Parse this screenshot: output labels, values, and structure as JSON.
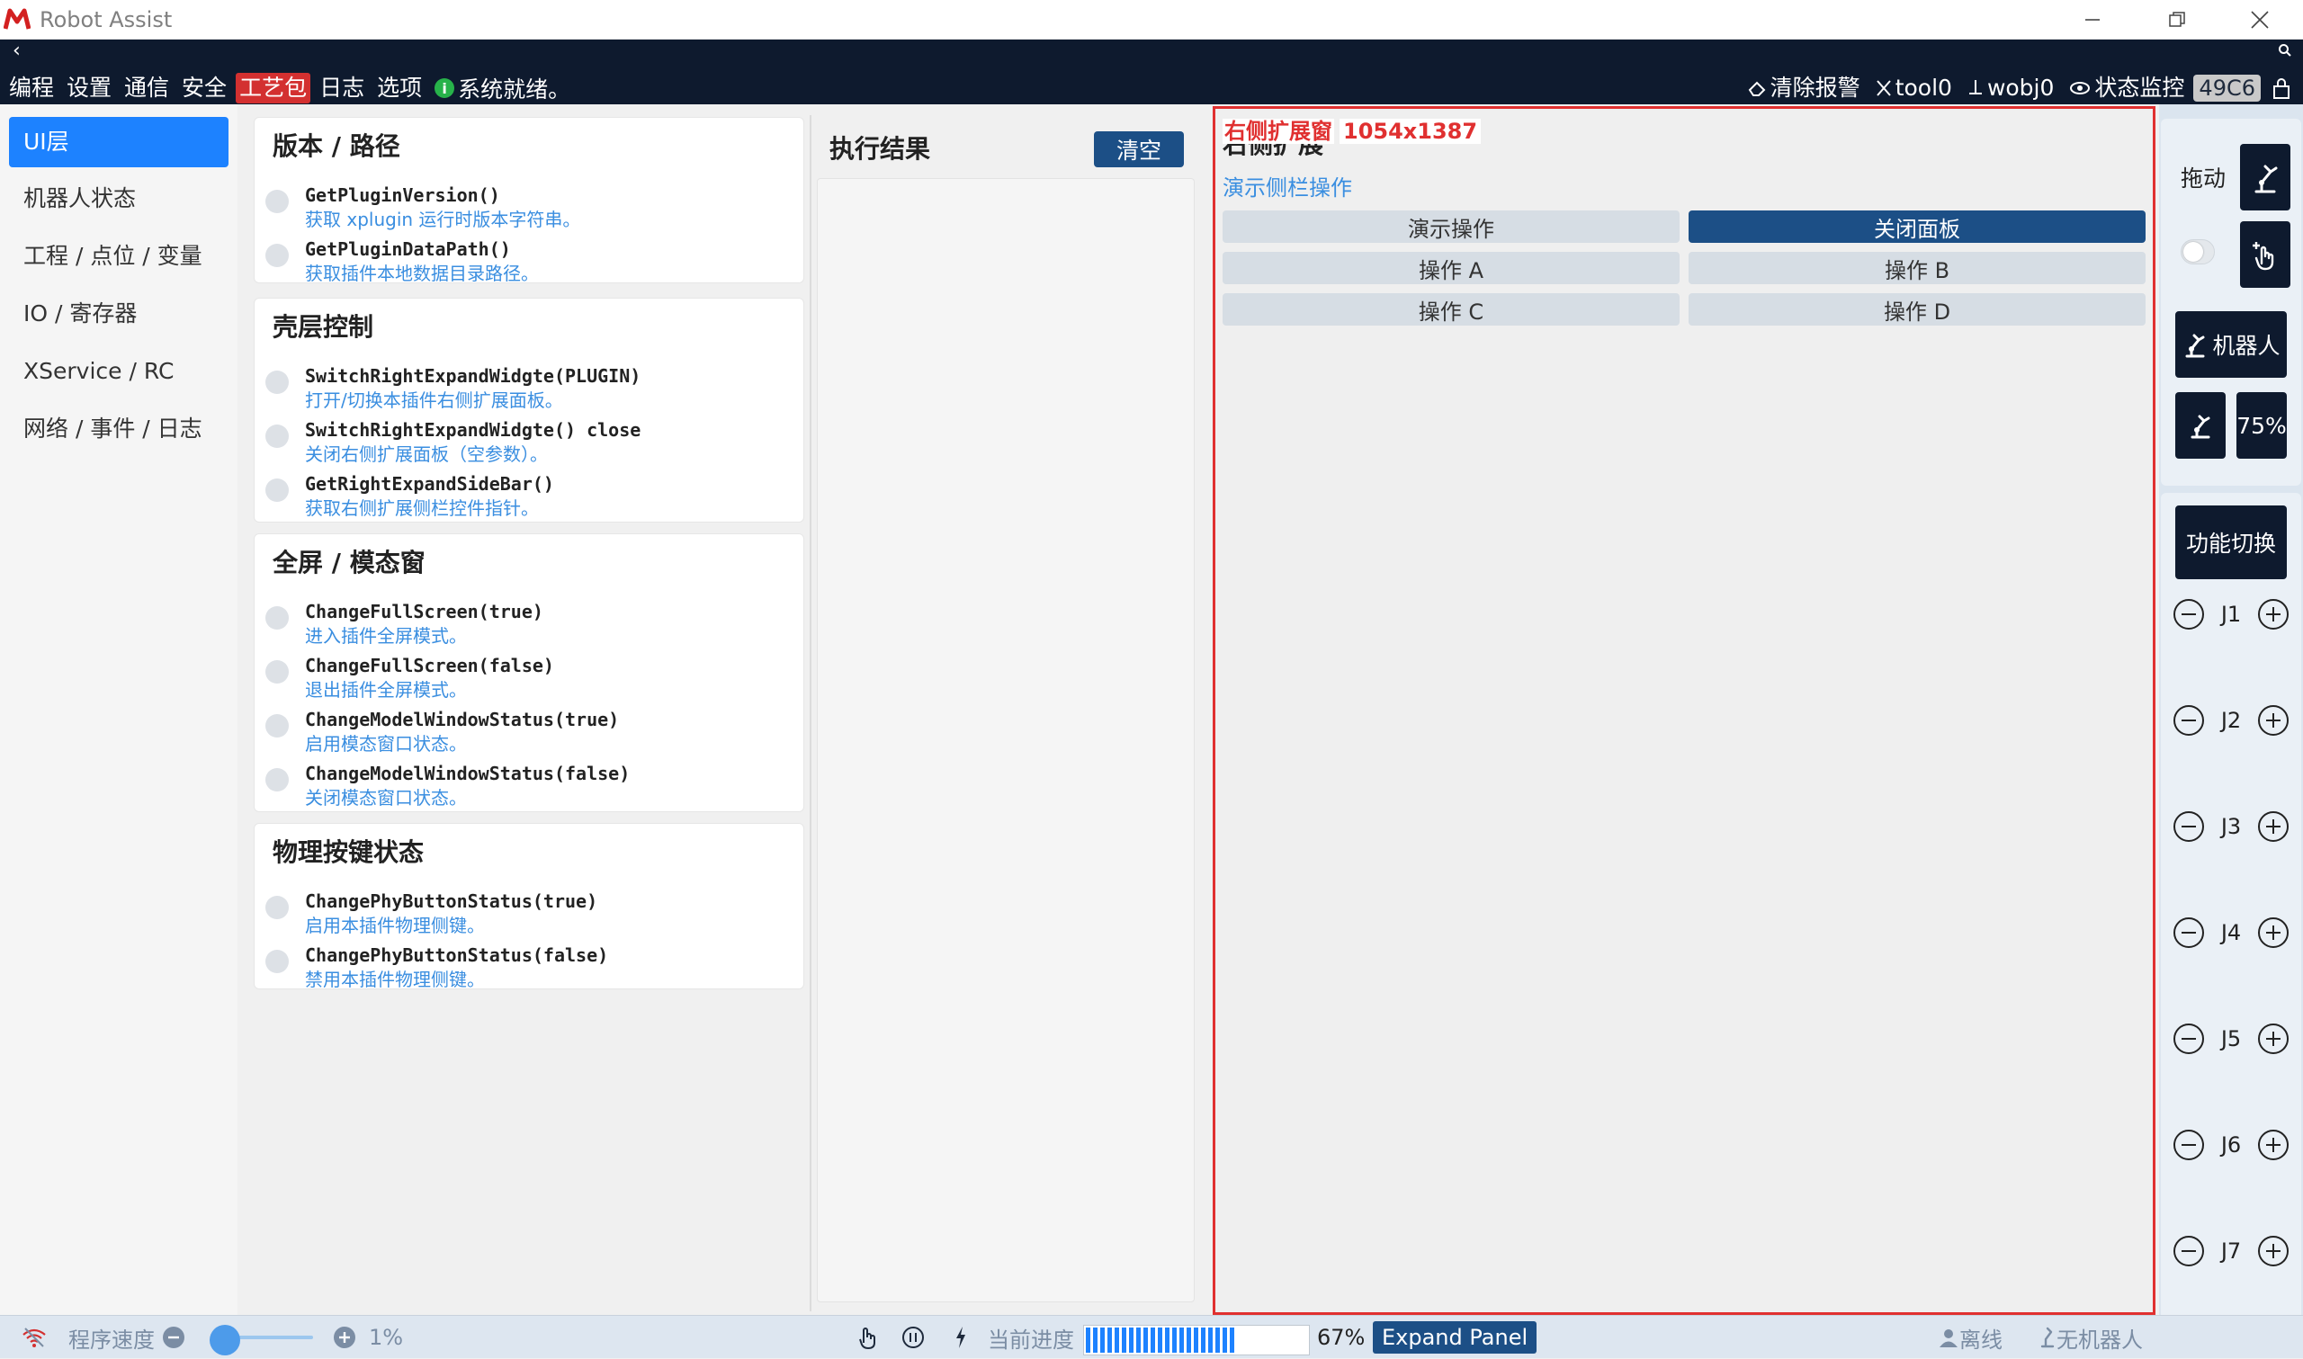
{
  "window": {
    "title": "Robot Assist"
  },
  "menu": {
    "items": [
      "编程",
      "设置",
      "通信",
      "安全",
      "工艺包",
      "日志",
      "选项"
    ],
    "active_index": 4,
    "status_text": "系统就绪。"
  },
  "topright": {
    "clear_alarm": "清除报警",
    "tool": "tool0",
    "wobj": "wobj0",
    "monitor": "状态监控",
    "code": "49C6"
  },
  "sidebar": {
    "items": [
      "UI层",
      "机器人状态",
      "工程 / 点位 / 变量",
      "IO / 寄存器",
      "XService / RC",
      "网络 / 事件 / 日志"
    ],
    "active_index": 0
  },
  "api_cards": [
    {
      "title": "版本 / 路径",
      "apis": [
        {
          "name": "GetPluginVersion()",
          "desc": "获取 xplugin 运行时版本字符串。"
        },
        {
          "name": "GetPluginDataPath()",
          "desc": "获取插件本地数据目录路径。"
        }
      ]
    },
    {
      "title": "壳层控制",
      "apis": [
        {
          "name": "SwitchRightExpandWidgte(PLUGIN)",
          "desc": "打开/切换本插件右侧扩展面板。"
        },
        {
          "name": "SwitchRightExpandWidgte() close",
          "desc": "关闭右侧扩展面板（空参数）。"
        },
        {
          "name": "GetRightExpandSideBar()",
          "desc": "获取右侧扩展侧栏控件指针。"
        }
      ]
    },
    {
      "title": "全屏 / 模态窗",
      "apis": [
        {
          "name": "ChangeFullScreen(true)",
          "desc": "进入插件全屏模式。"
        },
        {
          "name": "ChangeFullScreen(false)",
          "desc": "退出插件全屏模式。"
        },
        {
          "name": "ChangeModelWindowStatus(true)",
          "desc": "启用模态窗口状态。"
        },
        {
          "name": "ChangeModelWindowStatus(false)",
          "desc": "关闭模态窗口状态。"
        }
      ]
    },
    {
      "title": "物理按键状态",
      "apis": [
        {
          "name": "ChangePhyButtonStatus(true)",
          "desc": "启用本插件物理侧键。"
        },
        {
          "name": "ChangePhyButtonStatus(false)",
          "desc": "禁用本插件物理侧键。"
        }
      ]
    }
  ],
  "result": {
    "title": "执行结果",
    "clear_label": "清空"
  },
  "expand_panel": {
    "tag_name": "右侧扩展窗",
    "tag_size": "1054x1387",
    "title": "右侧扩展",
    "subtitle": "演示侧栏操作",
    "buttons": [
      "演示操作",
      "关闭面板",
      "操作 A",
      "操作 B",
      "操作 C",
      "操作 D"
    ]
  },
  "rightbar": {
    "drag_label": "拖动",
    "robot_label": "机器人",
    "speed_label": "75%",
    "func_label": "功能切换",
    "joints": [
      "J1",
      "J2",
      "J3",
      "J4",
      "J5",
      "J6",
      "J7"
    ]
  },
  "statusbar": {
    "speed_label": "程序速度",
    "speed_value": "1%",
    "speed_fraction": 0.01,
    "progress_label": "当前进度",
    "progress_value": "67%",
    "progress_fraction": 0.67,
    "expand_label": "Expand Panel",
    "offline": "离线",
    "no_robot": "无机器人"
  },
  "colors": {
    "accent": "#1d82ff",
    "dark": "#0e1a2e",
    "alert": "#e03030",
    "button": "#1c4f86",
    "link": "#3a8ee0"
  }
}
